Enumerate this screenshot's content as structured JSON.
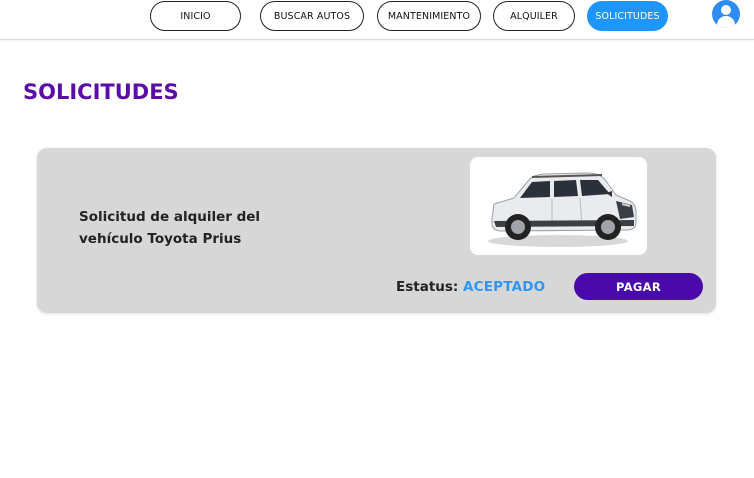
{
  "nav": {
    "items": [
      {
        "label": "INICIO",
        "active": false
      },
      {
        "label": "BUSCAR AUTOS",
        "active": false
      },
      {
        "label": "MANTENIMIENTO",
        "active": false
      },
      {
        "label": "ALQUILER",
        "active": false
      },
      {
        "label": "SOLICITUDES",
        "active": true
      }
    ],
    "avatar_icon": "user-avatar-icon"
  },
  "page": {
    "title": "SOLICITUDES"
  },
  "requests": [
    {
      "description": "Solicitud de alquiler del vehículo Toyota Prius",
      "vehicle_image": "white-suv-photo",
      "status_label": "Estatus:",
      "status_value": "ACEPTADO",
      "action_label": "PAGAR"
    }
  ],
  "colors": {
    "brand_purple": "#5b0ea6",
    "button_purple": "#4a0aaa",
    "accent_blue": "#1e95ff",
    "status_blue": "#2f96f5",
    "card_gray": "#d7d7d7"
  }
}
